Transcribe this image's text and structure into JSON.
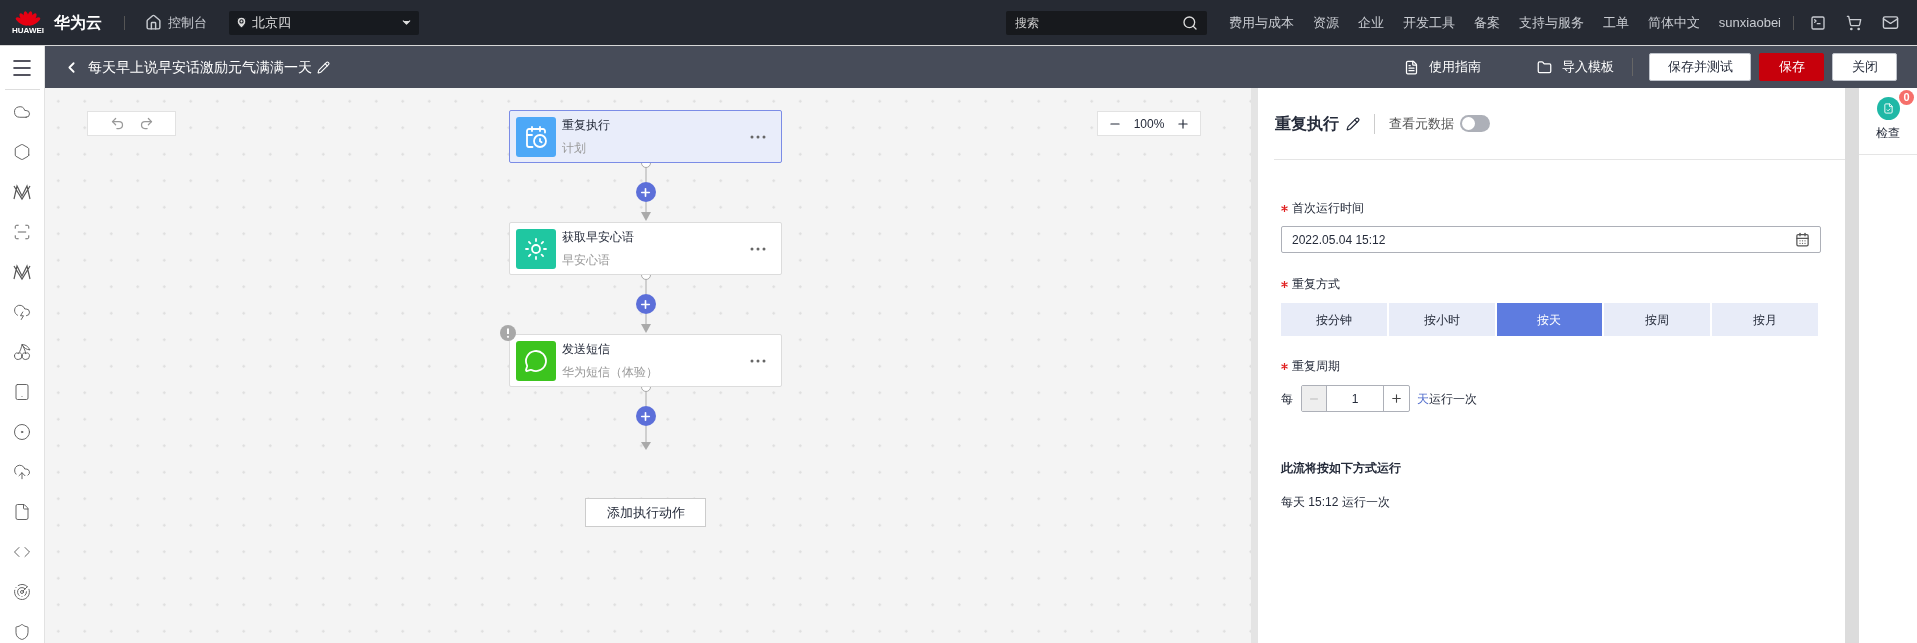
{
  "header": {
    "logo_text": "HUAWEI",
    "brand": "华为云",
    "console": "控制台",
    "region": "北京四",
    "search": {
      "placeholder": "搜索"
    },
    "nav": [
      "费用与成本",
      "资源",
      "企业",
      "开发工具",
      "备案",
      "支持与服务",
      "工单",
      "简体中文"
    ],
    "user": "sunxiaobei"
  },
  "toolbar": {
    "title": "每天早上说早安话激励元气满满一天",
    "links": [
      {
        "label": "使用指南",
        "kind": "guide"
      },
      {
        "label": "导入模板",
        "kind": "folder"
      }
    ],
    "buttons": [
      {
        "label": "保存并测试",
        "kind": "default"
      },
      {
        "label": "保存",
        "kind": "primary"
      },
      {
        "label": "关闭",
        "kind": "default"
      }
    ]
  },
  "canvas": {
    "zoom": "100%",
    "nodes": [
      {
        "title": "重复执行",
        "subtitle": "计划",
        "kind": "schedule",
        "selected": true,
        "warning": false
      },
      {
        "title": "获取早安心语",
        "subtitle": "早安心语",
        "kind": "sun",
        "selected": false,
        "warning": false
      },
      {
        "title": "发送短信",
        "subtitle": "华为短信（体验）",
        "kind": "chat",
        "selected": false,
        "warning": true
      }
    ],
    "add_action": "添加执行动作"
  },
  "panel": {
    "title": "重复执行",
    "metadata_toggle": {
      "label": "查看元数据",
      "on": false
    },
    "first_run": {
      "label": "首次运行时间",
      "required": true,
      "value": "2022.05.04 15:12"
    },
    "repeat_mode": {
      "label": "重复方式",
      "required": true,
      "options": [
        {
          "label": "按分钟",
          "selected": false
        },
        {
          "label": "按小时",
          "selected": false
        },
        {
          "label": "按天",
          "selected": true
        },
        {
          "label": "按周",
          "selected": false
        },
        {
          "label": "按月",
          "selected": false
        }
      ]
    },
    "repeat_period": {
      "label": "重复周期",
      "required": true,
      "prefix": "每",
      "value": "1",
      "unit": "天",
      "suffix": "运行一次"
    },
    "summary": {
      "heading": "此流将按如下方式运行",
      "text": "每天 15:12 运行一次"
    }
  },
  "check": {
    "label": "检查",
    "count": "0"
  }
}
